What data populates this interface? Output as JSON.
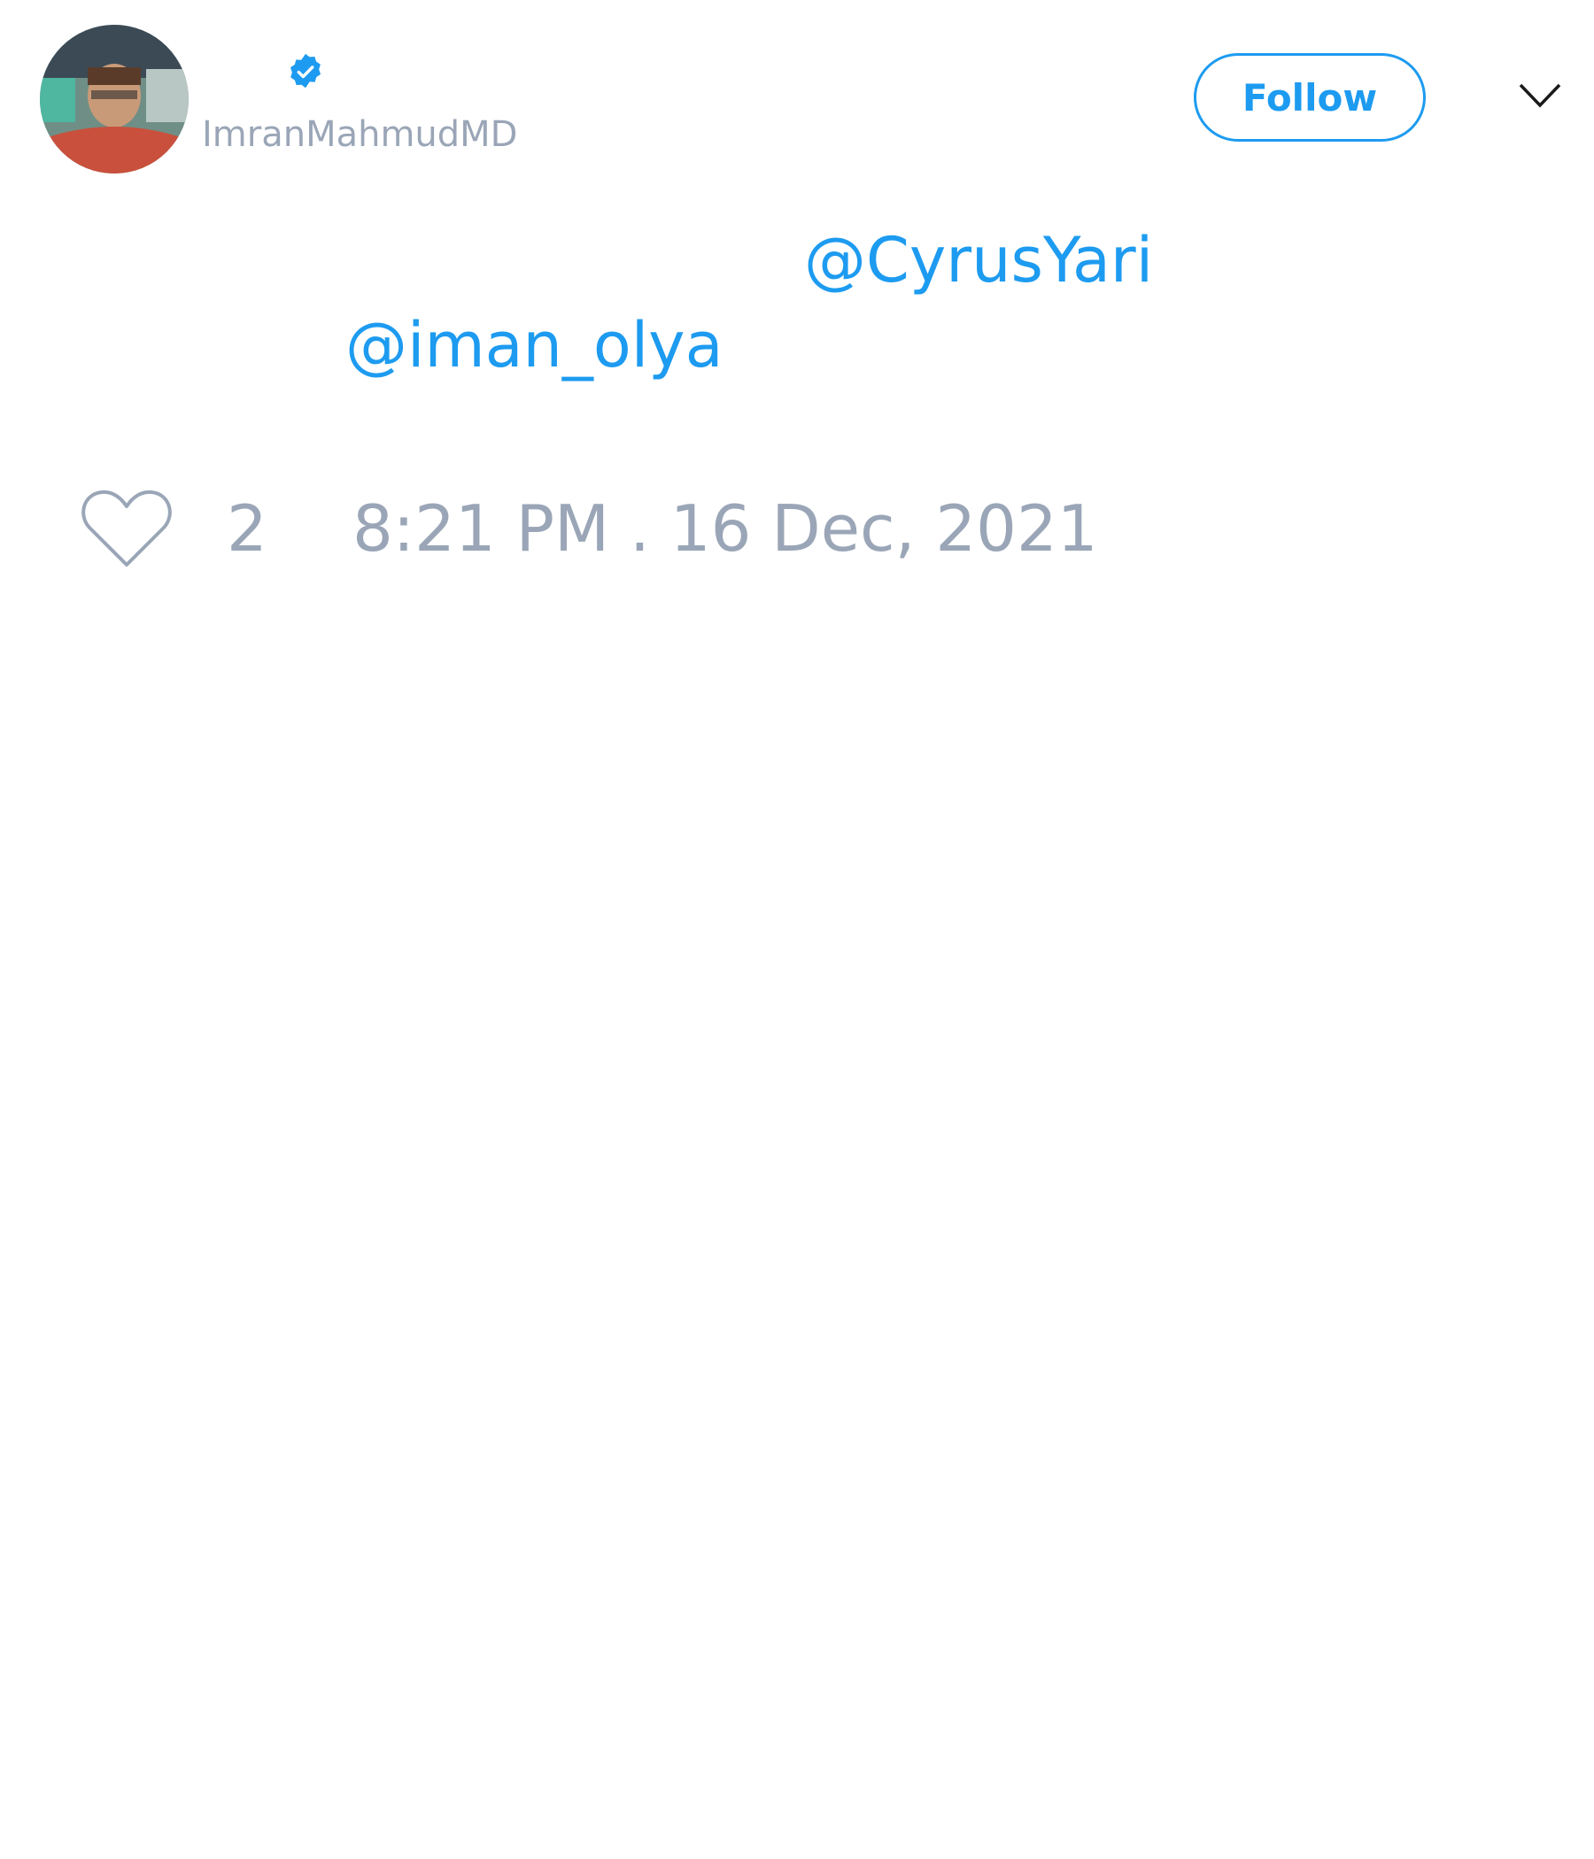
{
  "author": {
    "handle": "ImranMahmudMD",
    "verified": true,
    "avatar_icon": "profile-photo"
  },
  "header": {
    "follow_label": "Follow",
    "menu_icon": "chevron-down-icon"
  },
  "body": {
    "mentions": [
      "@CyrusYari",
      "@iman_olya"
    ]
  },
  "footer": {
    "like_icon": "heart-outline-icon",
    "like_count": "2",
    "timestamp": "8:21 PM . 16 Dec, 2021"
  },
  "colors": {
    "accent": "#1d9bf0",
    "muted": "#9aa6b7",
    "background": "#ffffff"
  }
}
